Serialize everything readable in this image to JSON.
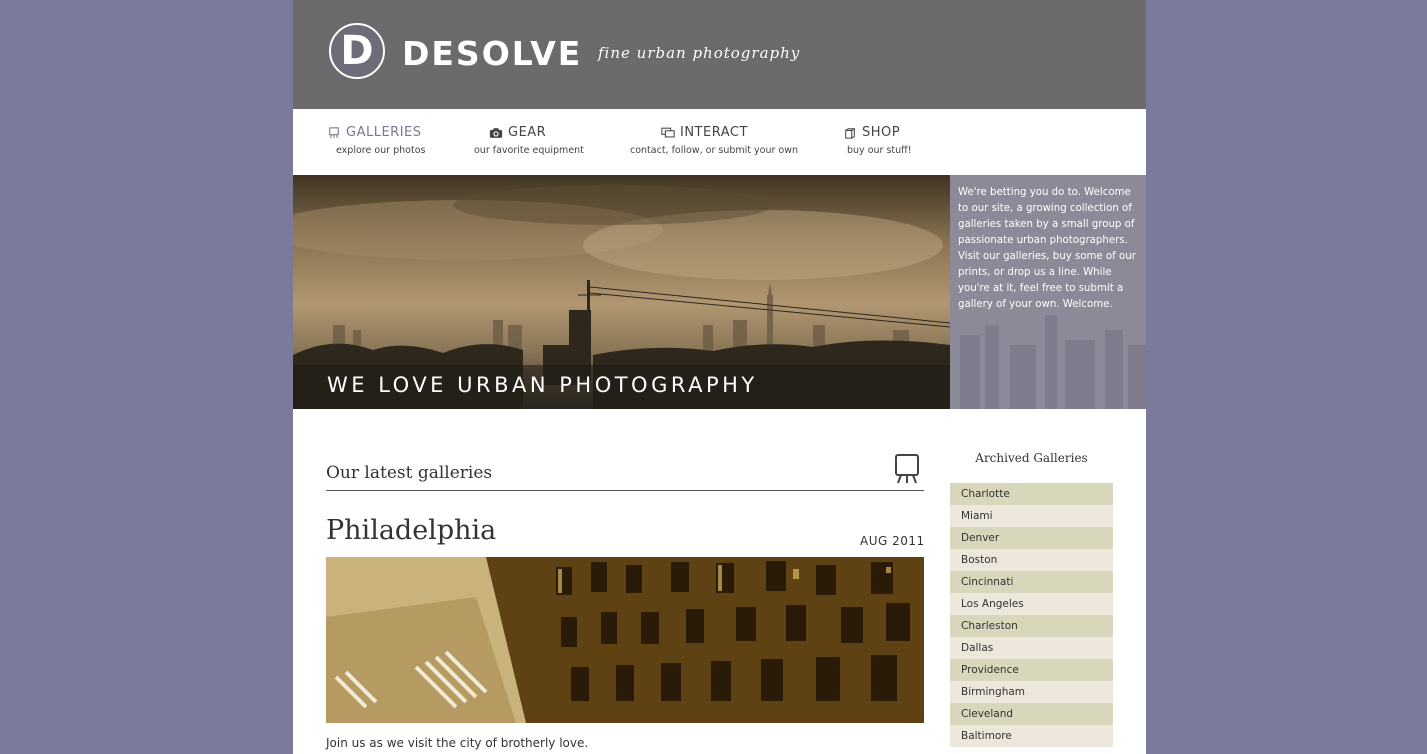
{
  "header": {
    "logo_letter": "D",
    "site_name": "DESOLVE",
    "tagline": "fine urban photography"
  },
  "nav": [
    {
      "title": "GALLERIES",
      "subtitle": "explore our photos",
      "icon": "easel-icon"
    },
    {
      "title": "GEAR",
      "subtitle": "our favorite equipment",
      "icon": "camera-icon"
    },
    {
      "title": "INTERACT",
      "subtitle": "contact, follow, or submit your own",
      "icon": "chat-icon"
    },
    {
      "title": "SHOP",
      "subtitle": "buy our stuff!",
      "icon": "bag-icon"
    }
  ],
  "hero": {
    "title": "WE LOVE URBAN PHOTOGRAPHY",
    "side_text": "We're betting you do to. Welcome to our site, a growing collection of galleries taken by a small group of passionate urban photographers. Visit our galleries, buy some of our prints, or drop us a line. While you're at it, feel free to submit a gallery of your own. Welcome."
  },
  "latest": {
    "section_title": "Our latest galleries",
    "gallery_title": "Philadelphia",
    "gallery_date": "AUG 2011",
    "gallery_desc": "Join us as we visit the city of brotherly love."
  },
  "archive": {
    "title": "Archived Galleries",
    "items": [
      "Charlotte",
      "Miami",
      "Denver",
      "Boston",
      "Cincinnati",
      "Los Angeles",
      "Charleston",
      "Dallas",
      "Providence",
      "Birmingham",
      "Cleveland",
      "Baltimore"
    ]
  },
  "colors": {
    "background": "#7c7a9b",
    "header": "#6b6a6c",
    "archive_odd": "#d8d7bc",
    "archive_even": "#ede6da"
  }
}
